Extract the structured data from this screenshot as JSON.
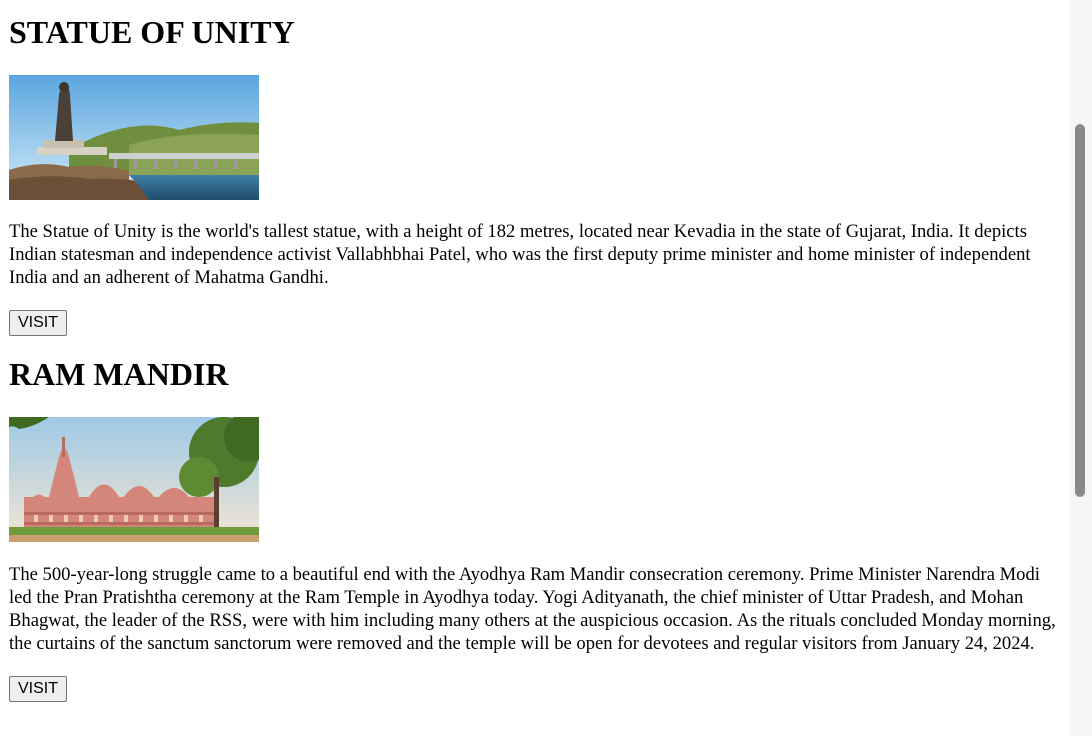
{
  "attractions": [
    {
      "title": "STATUE OF UNITY",
      "image_alt": "Statue of Unity",
      "description": "The Statue of Unity is the world's tallest statue, with a height of 182 metres, located near Kevadia in the state of Gujarat, India. It depicts Indian statesman and independence activist Vallabhbhai Patel, who was the first deputy prime minister and home minister of independent India and an adherent of Mahatma Gandhi.",
      "button_label": "VISIT"
    },
    {
      "title": "RAM MANDIR",
      "image_alt": "Ram Mandir",
      "description": "The 500-year-long struggle came to a beautiful end with the Ayodhya Ram Mandir consecration ceremony. Prime Minister Narendra Modi led the Pran Pratishtha ceremony at the Ram Temple in Ayodhya today. Yogi Adityanath, the chief minister of Uttar Pradesh, and Mohan Bhagwat, the leader of the RSS, were with him including many others at the auspicious occasion. As the rituals concluded Monday morning, the curtains of the sanctum sanctorum were removed and the temple will be open for devotees and regular visitors from January 24, 2024.",
      "button_label": "VISIT"
    }
  ]
}
